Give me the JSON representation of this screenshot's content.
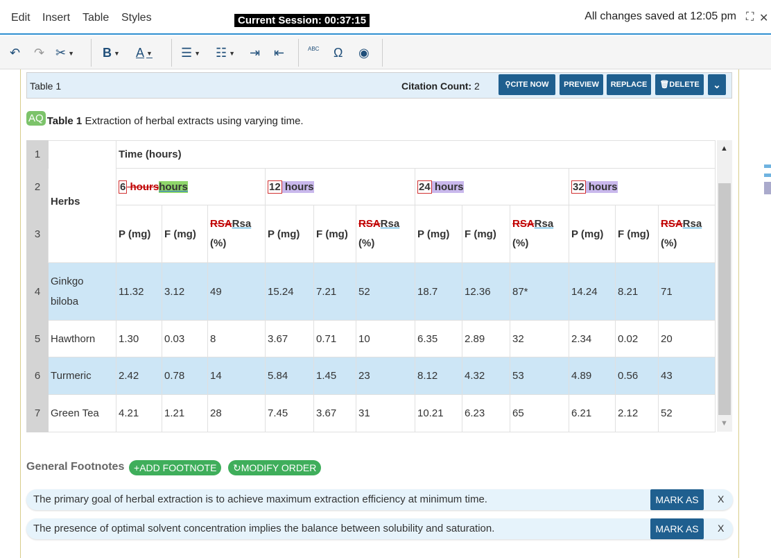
{
  "menu": {
    "items": [
      "Edit",
      "Insert",
      "Table",
      "Styles"
    ]
  },
  "session": "Current Session: 00:37:15",
  "saved": "All changes saved at 12:05 pm",
  "icons": {
    "undo": "↶",
    "redo": "↷",
    "cut": "✂",
    "bold": "B",
    "font_color": "A",
    "bullets": "☰",
    "numbered": "☷",
    "indent": "⇥",
    "outdent": "⇤",
    "spellcheck": "ABC",
    "omega": "Ω",
    "eye": "◉",
    "expand": "⛶",
    "close": "✕"
  },
  "table_header": {
    "label": "Table 1",
    "citation_label": "Citation Count:",
    "citation_count": "2",
    "buttons": {
      "cite": "CITE NOW",
      "preview": "PREVIEW",
      "replace": "REPLACE",
      "delete": "DELETE"
    }
  },
  "caption": {
    "badge": "AQ",
    "label": "Table 1",
    "text": "Extraction of herbal extracts using varying time."
  },
  "table": {
    "row_numbers": [
      "1",
      "2",
      "3",
      "4",
      "5",
      "6",
      "7"
    ],
    "herbs_header": "Herbs",
    "time_header": "Time (hours)",
    "groups": [
      {
        "num": "6",
        "deleted": " hours",
        "inserted": "hours",
        "unit": ""
      },
      {
        "num": "12",
        "deleted": "",
        "inserted": "",
        "unit": " hours"
      },
      {
        "num": "24",
        "deleted": "",
        "inserted": "",
        "unit": " hours"
      },
      {
        "num": "32",
        "deleted": "",
        "inserted": "",
        "unit": " hours"
      }
    ],
    "sub": {
      "p": "P (mg)",
      "f": "F (mg)",
      "rsa_deleted": "RSA",
      "rsa_inserted": "Rsa",
      "rsa_unit": "(%)"
    },
    "rows": [
      {
        "herb": "Ginkgo biloba",
        "values": [
          "11.32",
          "3.12",
          "49",
          "15.24",
          "7.21",
          "52",
          "18.7",
          "12.36",
          "87*",
          "14.24",
          "8.21",
          "71"
        ]
      },
      {
        "herb": "Hawthorn",
        "values": [
          "1.30",
          "0.03",
          "8",
          "3.67",
          "0.71",
          "10",
          "6.35",
          "2.89",
          "32",
          "2.34",
          "0.02",
          "20"
        ]
      },
      {
        "herb": "Turmeric",
        "values": [
          "2.42",
          "0.78",
          "14",
          "5.84",
          "1.45",
          "23",
          "8.12",
          "4.32",
          "53",
          "4.89",
          "0.56",
          "43"
        ]
      },
      {
        "herb": "Green Tea",
        "values": [
          "4.21",
          "1.21",
          "28",
          "7.45",
          "3.67",
          "31",
          "10.21",
          "6.23",
          "65",
          "6.21",
          "2.12",
          "52"
        ]
      }
    ]
  },
  "footnotes": {
    "label": "General Footnotes",
    "add": "ADD FOOTNOTE",
    "modify": "MODIFY ORDER",
    "items": [
      {
        "text": "The primary goal of herbal extraction is to achieve maximum extraction efficiency at minimum time.",
        "mark": "MARK AS",
        "close": "X"
      },
      {
        "text": "The presence of optimal solvent concentration implies the balance between solubility and saturation.",
        "mark": "MARK AS",
        "close": "X"
      }
    ]
  },
  "colors": {
    "accent": "#1f5f8f",
    "highlight_row": "#cde6f6",
    "green": "#3fae5b",
    "insert_purple": "#c9b8ec",
    "insert_green": "#8fd66a"
  }
}
